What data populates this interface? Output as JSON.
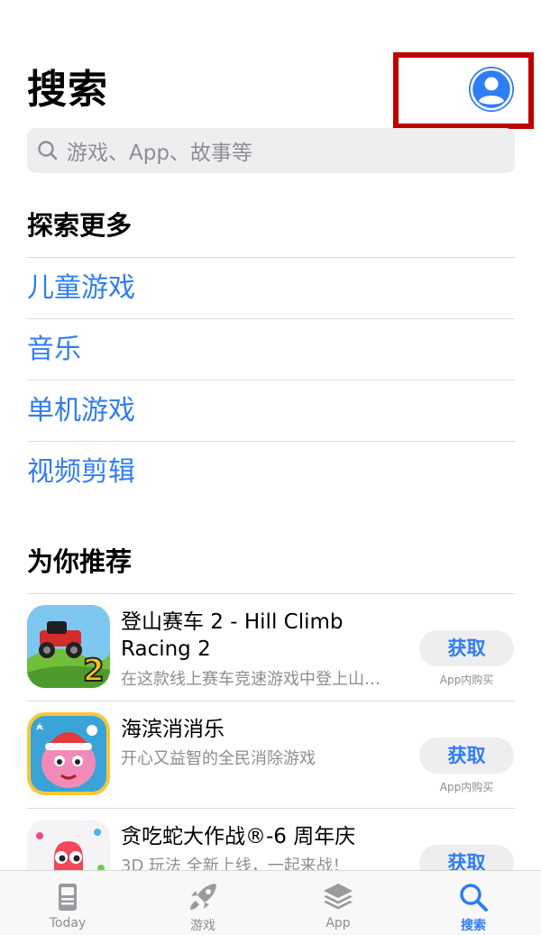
{
  "header": {
    "title": "搜索"
  },
  "search": {
    "placeholder": "游戏、App、故事等"
  },
  "explore": {
    "title": "探索更多",
    "items": [
      {
        "label": "儿童游戏"
      },
      {
        "label": "音乐"
      },
      {
        "label": "单机游戏"
      },
      {
        "label": "视频剪辑"
      }
    ]
  },
  "recommend": {
    "title": "为你推荐",
    "apps": [
      {
        "name": "登山赛车 2 - Hill Climb Racing 2",
        "desc": "在这款线上赛车竞速游戏中登上山…",
        "button": "获取",
        "iap": "App内购买",
        "icon": "hill-climb-racing-icon"
      },
      {
        "name": "海滨消消乐",
        "desc": "开心又益智的全民消除游戏",
        "button": "获取",
        "iap": "App内购买",
        "icon": "seaside-match-icon"
      },
      {
        "name": "贪吃蛇大作战®-6 周年庆",
        "desc": "3D 玩法 全新上线，一起来战！",
        "button": "获取",
        "iap": "",
        "icon": "snake-game-icon"
      }
    ]
  },
  "tabbar": {
    "tabs": [
      {
        "label": "Today",
        "icon": "today-icon",
        "active": false
      },
      {
        "label": "游戏",
        "icon": "rocket-icon",
        "active": false
      },
      {
        "label": "App",
        "icon": "app-stack-icon",
        "active": false
      },
      {
        "label": "搜索",
        "icon": "search-icon",
        "active": true
      }
    ]
  },
  "colors": {
    "accent": "#2f7df6",
    "highlight": "#c00000",
    "secondary_text": "#8e8e93"
  }
}
